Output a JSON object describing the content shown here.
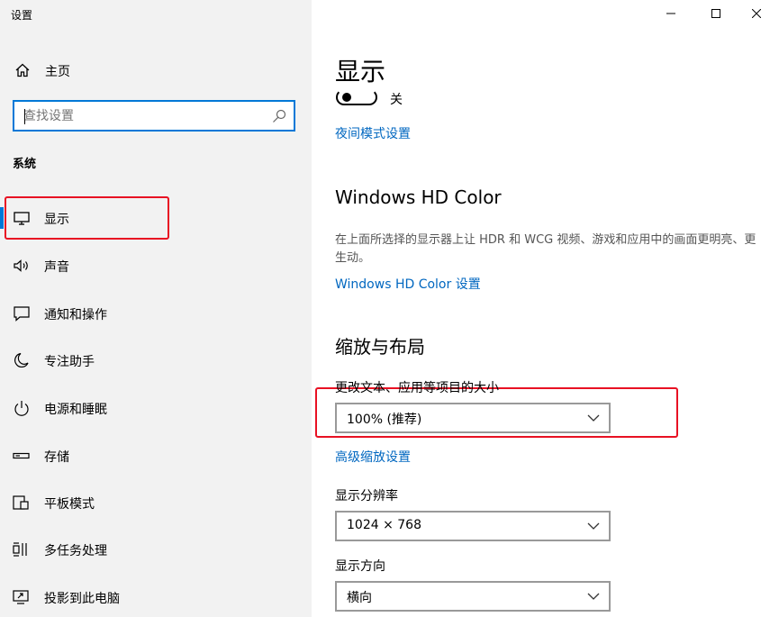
{
  "window": {
    "title": "设置",
    "controls": [
      "minimize",
      "maximize",
      "close"
    ]
  },
  "sidebar": {
    "home_label": "主页",
    "search_placeholder": "查找设置",
    "section_label": "系统",
    "items": [
      {
        "label": "显示",
        "icon": "monitor-icon",
        "selected": true
      },
      {
        "label": "声音",
        "icon": "speaker-icon"
      },
      {
        "label": "通知和操作",
        "icon": "notification-icon"
      },
      {
        "label": "专注助手",
        "icon": "moon-icon"
      },
      {
        "label": "电源和睡眠",
        "icon": "power-icon"
      },
      {
        "label": "存储",
        "icon": "storage-icon"
      },
      {
        "label": "平板模式",
        "icon": "tablet-icon"
      },
      {
        "label": "多任务处理",
        "icon": "multitask-icon"
      },
      {
        "label": "投影到此电脑",
        "icon": "project-icon"
      }
    ]
  },
  "main": {
    "title": "显示",
    "night_light": {
      "state_label": "关",
      "settings_link": "夜间模式设置"
    },
    "hd_color": {
      "title": "Windows HD Color",
      "description": "在上面所选择的显示器上让 HDR 和 WCG 视频、游戏和应用中的画面更明亮、更生动。",
      "settings_link": "Windows HD Color 设置"
    },
    "scale_layout": {
      "title": "缩放与布局",
      "scale_label": "更改文本、应用等项目的大小",
      "scale_value": "100% (推荐)",
      "advanced_link": "高级缩放设置",
      "resolution_label": "显示分辨率",
      "resolution_value": "1024 × 768",
      "orientation_label": "显示方向",
      "orientation_value": "横向"
    }
  },
  "colors": {
    "accent": "#0078d7",
    "link": "#0067c0",
    "highlight_box": "#e81123",
    "sidebar_bg": "#f2f2f2"
  }
}
